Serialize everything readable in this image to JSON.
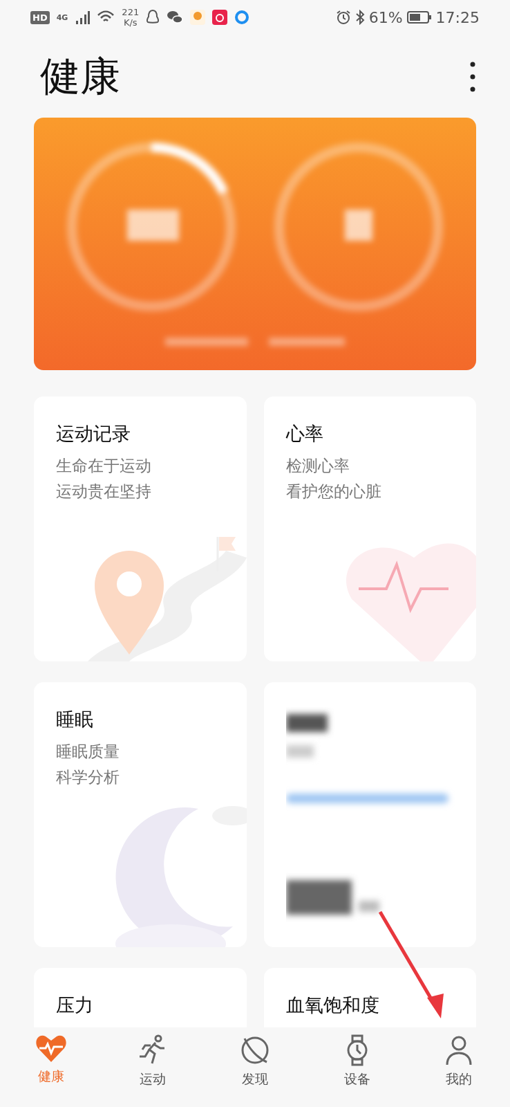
{
  "status_bar": {
    "hd": "HD",
    "network": "4G",
    "speed_value": "221",
    "speed_unit": "K/s",
    "battery": "61%",
    "time": "17:25"
  },
  "header": {
    "title": "健康"
  },
  "cards": [
    {
      "kind": "feature",
      "title": "运动记录",
      "lines": [
        "生命在于运动",
        "运动贵在坚持"
      ]
    },
    {
      "kind": "feature",
      "title": "心率",
      "lines": [
        "检测心率",
        "看护您的心脏"
      ]
    },
    {
      "kind": "feature",
      "title": "睡眠",
      "lines": [
        "睡眠质量",
        "科学分析"
      ]
    },
    {
      "kind": "blurred"
    },
    {
      "kind": "feature",
      "title": "压力"
    },
    {
      "kind": "feature",
      "title": "血氧饱和度"
    }
  ],
  "nav": [
    {
      "label": "健康",
      "selected": true
    },
    {
      "label": "运动",
      "selected": false
    },
    {
      "label": "发现",
      "selected": false
    },
    {
      "label": "设备",
      "selected": false
    },
    {
      "label": "我的",
      "selected": false
    }
  ]
}
